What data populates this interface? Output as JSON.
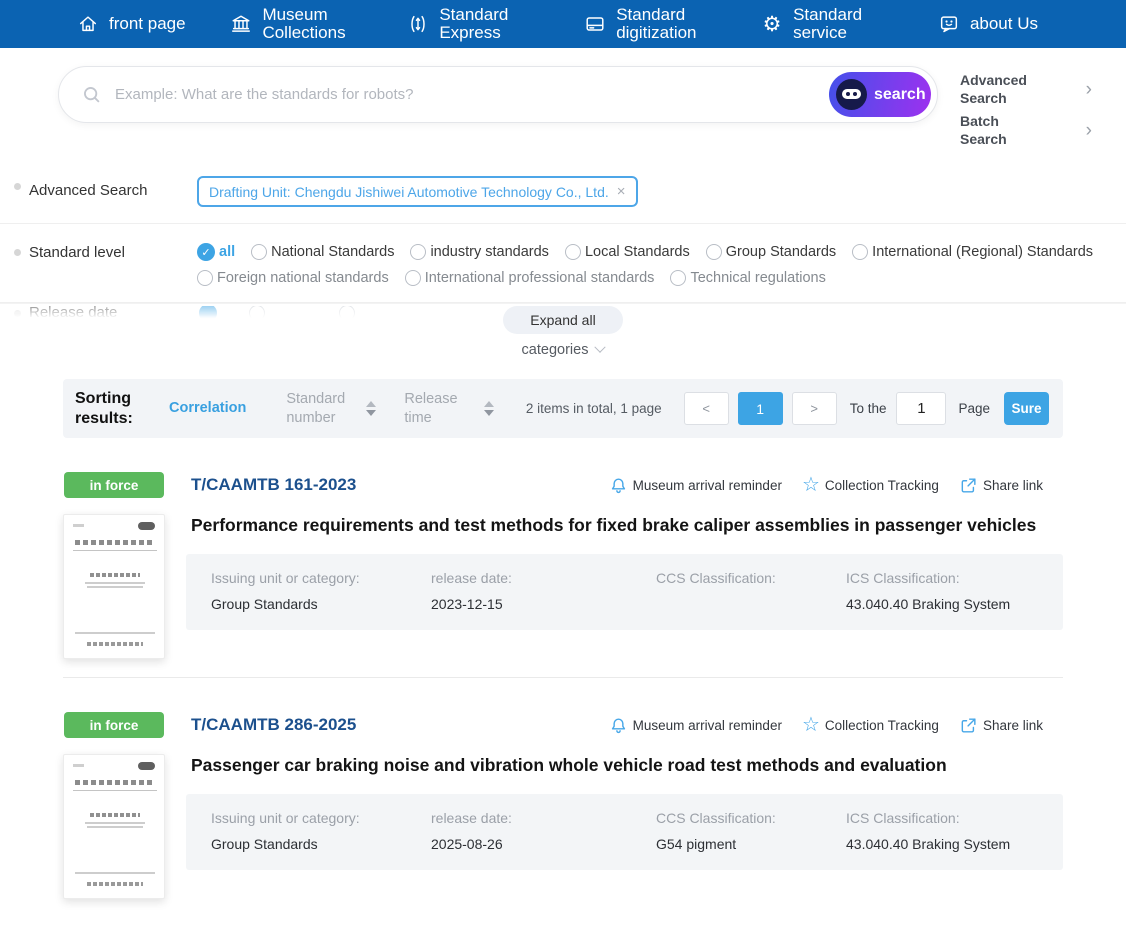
{
  "colors": {
    "nav-blue": "#0b63b2",
    "accent": "#3da4e4",
    "link-blue": "#4da6e8",
    "navy": "#1c508d",
    "green": "#5bb95d",
    "icon-blue": "#47a7e8",
    "grad-start": "#4450ea",
    "grad-end": "#9d31ef"
  },
  "glyphs": {
    "close": "×",
    "chevron": "›",
    "star": "☆",
    "gear": "⚙",
    "check": "✓"
  },
  "nav": {
    "items": [
      {
        "label": "front page",
        "icon": "home-icon"
      },
      {
        "label": "Museum Collections",
        "icon": "museum-icon"
      },
      {
        "label": "Standard Express",
        "icon": "express-icon"
      },
      {
        "label": "Standard digitization",
        "icon": "digitization-icon"
      },
      {
        "label": "Standard service",
        "icon": "service-gear-icon"
      },
      {
        "label": "about Us",
        "icon": "chat-smiley-icon"
      }
    ]
  },
  "search": {
    "placeholder": "Example: What are the standards for robots?",
    "button_label": "search",
    "advanced_link": "Advanced Search",
    "batch_link": "Batch Search"
  },
  "filters": {
    "advanced_label": "Advanced Search",
    "tag": "Drafting Unit: Chengdu Jishiwei Automotive Technology Co., Ltd.",
    "standard_level_label": "Standard level",
    "options_row1": [
      "all",
      "National Standards",
      "industry standards",
      "Local Standards",
      "Group Standards",
      "International (Regional) Standards"
    ],
    "options_row2": [
      "Foreign national standards",
      "International professional standards",
      "Technical regulations"
    ],
    "selected_option": "all",
    "collapsed_label": "Release date",
    "expand_button": "Expand all",
    "categories_label": "categories"
  },
  "sorting": {
    "label": "Sorting results:",
    "tab_correlation": "Correlation",
    "tab_standard_number": "Standard number",
    "tab_release_time": "Release time",
    "summary": "2 items in total, 1 page",
    "prev": "<",
    "current_page": "1",
    "next": ">",
    "goto_prefix": "To the",
    "goto_value": "1",
    "goto_suffix": "Page",
    "confirm": "Sure"
  },
  "results_actions": [
    "Museum arrival reminder",
    "Collection Tracking",
    "Share link"
  ],
  "results": [
    {
      "status": "in force",
      "number": "T/CAAMTB 161-2023",
      "title": "Performance requirements and test methods for fixed brake caliper assemblies in passenger vehicles",
      "fields": [
        {
          "label": "Issuing unit or category:",
          "value": "Group Standards"
        },
        {
          "label": "release date:",
          "value": "2023-12-15"
        },
        {
          "label": "CCS Classification:",
          "value": ""
        },
        {
          "label": "ICS Classification:",
          "value": "43.040.40 Braking System"
        }
      ]
    },
    {
      "status": "in force",
      "number": "T/CAAMTB 286-2025",
      "title": "Passenger car braking noise and vibration whole vehicle road test methods and evaluation",
      "fields": [
        {
          "label": "Issuing unit or category:",
          "value": "Group Standards"
        },
        {
          "label": "release date:",
          "value": "2025-08-26"
        },
        {
          "label": "CCS Classification:",
          "value": "G54 pigment"
        },
        {
          "label": "ICS Classification:",
          "value": "43.040.40 Braking System"
        }
      ]
    }
  ]
}
